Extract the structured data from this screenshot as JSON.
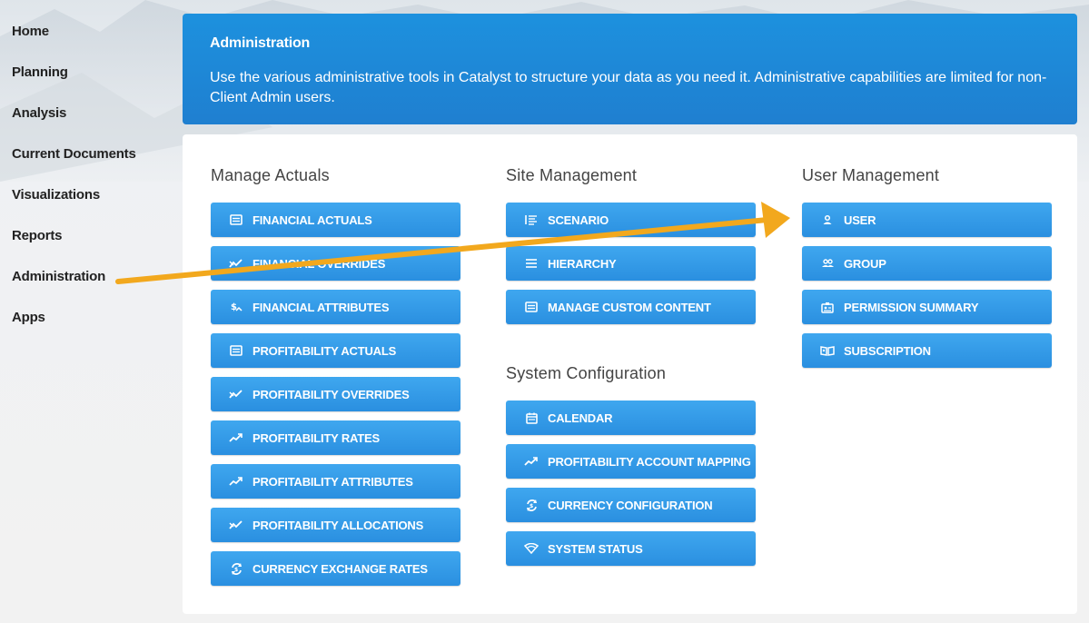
{
  "sidebar": {
    "items": [
      {
        "label": "Home"
      },
      {
        "label": "Planning"
      },
      {
        "label": "Analysis"
      },
      {
        "label": "Current Documents"
      },
      {
        "label": "Visualizations"
      },
      {
        "label": "Reports"
      },
      {
        "label": "Administration"
      },
      {
        "label": "Apps"
      }
    ]
  },
  "banner": {
    "title": "Administration",
    "text": "Use the various administrative tools in Catalyst to structure your data as you need it. Administrative capabilities are limited for non-Client Admin users."
  },
  "sections": {
    "manage_actuals": {
      "heading": "Manage Actuals",
      "buttons": [
        {
          "label": "FINANCIAL ACTUALS",
          "icon": "table-icon"
        },
        {
          "label": "FINANCIAL OVERRIDES",
          "icon": "override-chart-icon"
        },
        {
          "label": "FINANCIAL ATTRIBUTES",
          "icon": "attribute-icon"
        },
        {
          "label": "PROFITABILITY ACTUALS",
          "icon": "table-icon"
        },
        {
          "label": "PROFITABILITY OVERRIDES",
          "icon": "override-chart-icon"
        },
        {
          "label": "PROFITABILITY RATES",
          "icon": "trend-icon"
        },
        {
          "label": "PROFITABILITY ATTRIBUTES",
          "icon": "trend-icon"
        },
        {
          "label": "PROFITABILITY ALLOCATIONS",
          "icon": "override-chart-icon"
        },
        {
          "label": "CURRENCY EXCHANGE RATES",
          "icon": "currency-exchange-icon"
        }
      ]
    },
    "site_management": {
      "heading": "Site Management",
      "buttons": [
        {
          "label": "SCENARIO",
          "icon": "scenario-icon"
        },
        {
          "label": "HIERARCHY",
          "icon": "list-icon"
        },
        {
          "label": "MANAGE CUSTOM CONTENT",
          "icon": "table-icon"
        }
      ]
    },
    "system_configuration": {
      "heading": "System Configuration",
      "buttons": [
        {
          "label": "CALENDAR",
          "icon": "calendar-icon"
        },
        {
          "label": "PROFITABILITY ACCOUNT MAPPING",
          "icon": "trend-icon"
        },
        {
          "label": "CURRENCY CONFIGURATION",
          "icon": "currency-exchange-icon"
        },
        {
          "label": "SYSTEM STATUS",
          "icon": "wifi-icon"
        }
      ]
    },
    "user_management": {
      "heading": "User Management",
      "buttons": [
        {
          "label": "USER",
          "icon": "user-icon"
        },
        {
          "label": "GROUP",
          "icon": "group-icon"
        },
        {
          "label": "PERMISSION SUMMARY",
          "icon": "id-badge-icon"
        },
        {
          "label": "SUBSCRIPTION",
          "icon": "subscription-icon"
        }
      ]
    }
  },
  "colors": {
    "banner": "#1f86d6",
    "button": "#3399e8",
    "annotation_arrow": "#f2a81d"
  }
}
